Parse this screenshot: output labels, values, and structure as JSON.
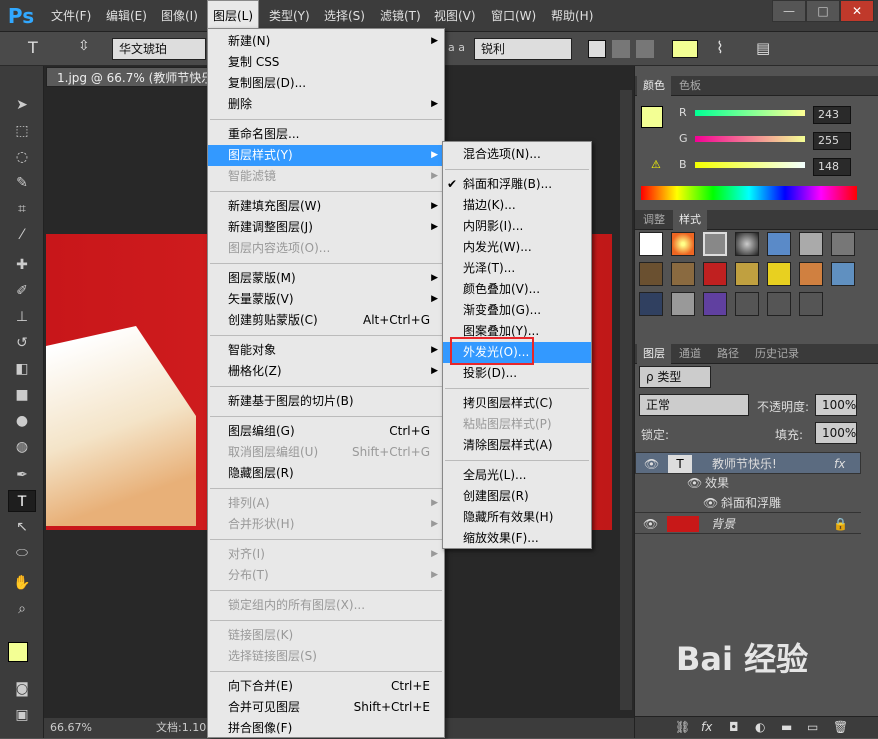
{
  "app": {
    "logo": "Ps"
  },
  "menubar": [
    "文件(F)",
    "编辑(E)",
    "图像(I)",
    "图层(L)",
    "类型(Y)",
    "选择(S)",
    "滤镜(T)",
    "视图(V)",
    "窗口(W)",
    "帮助(H)"
  ],
  "window_controls": [
    "—",
    "□",
    "✕"
  ],
  "options": {
    "tool_glyph": "T",
    "font": "华文琥珀",
    "aa_label": "a a",
    "aa_value": "锐利"
  },
  "document": {
    "tab": "1.jpg @ 66.7% (教师节快乐",
    "zoom": "66.67%",
    "doc_info": "文档:1.10"
  },
  "layer_menu": [
    {
      "label": "新建(N)",
      "arrow": true
    },
    {
      "label": "复制 CSS"
    },
    {
      "label": "复制图层(D)..."
    },
    {
      "label": "删除",
      "arrow": true
    },
    {
      "sep": true
    },
    {
      "label": "重命名图层..."
    },
    {
      "label": "图层样式(Y)",
      "arrow": true,
      "hl": true
    },
    {
      "label": "智能滤镜",
      "arrow": true,
      "dis": true
    },
    {
      "sep": true
    },
    {
      "label": "新建填充图层(W)",
      "arrow": true
    },
    {
      "label": "新建调整图层(J)",
      "arrow": true
    },
    {
      "label": "图层内容选项(O)...",
      "dis": true
    },
    {
      "sep": true
    },
    {
      "label": "图层蒙版(M)",
      "arrow": true
    },
    {
      "label": "矢量蒙版(V)",
      "arrow": true
    },
    {
      "label": "创建剪贴蒙版(C)",
      "sc": "Alt+Ctrl+G"
    },
    {
      "sep": true
    },
    {
      "label": "智能对象",
      "arrow": true
    },
    {
      "label": "栅格化(Z)",
      "arrow": true
    },
    {
      "sep": true
    },
    {
      "label": "新建基于图层的切片(B)"
    },
    {
      "sep": true
    },
    {
      "label": "图层编组(G)",
      "sc": "Ctrl+G"
    },
    {
      "label": "取消图层编组(U)",
      "sc": "Shift+Ctrl+G",
      "dis": true
    },
    {
      "label": "隐藏图层(R)"
    },
    {
      "sep": true
    },
    {
      "label": "排列(A)",
      "arrow": true,
      "dis": true
    },
    {
      "label": "合并形状(H)",
      "arrow": true,
      "dis": true
    },
    {
      "sep": true
    },
    {
      "label": "对齐(I)",
      "arrow": true,
      "dis": true
    },
    {
      "label": "分布(T)",
      "arrow": true,
      "dis": true
    },
    {
      "sep": true
    },
    {
      "label": "锁定组内的所有图层(X)...",
      "dis": true
    },
    {
      "sep": true
    },
    {
      "label": "链接图层(K)",
      "dis": true
    },
    {
      "label": "选择链接图层(S)",
      "dis": true
    },
    {
      "sep": true
    },
    {
      "label": "向下合并(E)",
      "sc": "Ctrl+E"
    },
    {
      "label": "合并可见图层",
      "sc": "Shift+Ctrl+E"
    },
    {
      "label": "拼合图像(F)"
    }
  ],
  "style_menu": [
    {
      "label": "混合选项(N)..."
    },
    {
      "sep": true
    },
    {
      "label": "斜面和浮雕(B)...",
      "check": true
    },
    {
      "label": "描边(K)..."
    },
    {
      "label": "内阴影(I)..."
    },
    {
      "label": "内发光(W)..."
    },
    {
      "label": "光泽(T)..."
    },
    {
      "label": "颜色叠加(V)..."
    },
    {
      "label": "渐变叠加(G)..."
    },
    {
      "label": "图案叠加(Y)..."
    },
    {
      "label": "外发光(O)...",
      "hl": true
    },
    {
      "label": "投影(D)..."
    },
    {
      "sep": true
    },
    {
      "label": "拷贝图层样式(C)"
    },
    {
      "label": "粘贴图层样式(P)",
      "dis": true
    },
    {
      "label": "清除图层样式(A)"
    },
    {
      "sep": true
    },
    {
      "label": "全局光(L)..."
    },
    {
      "label": "创建图层(R)"
    },
    {
      "label": "隐藏所有效果(H)"
    },
    {
      "label": "缩放效果(F)..."
    }
  ],
  "color_panel": {
    "tabs": [
      "颜色",
      "色板"
    ],
    "R": "243",
    "G": "255",
    "B": "148",
    "fg": "#f3ff94"
  },
  "styles_panel": {
    "tabs": [
      "调整",
      "样式"
    ]
  },
  "layers_panel": {
    "tabs": [
      "图层",
      "通道",
      "路径",
      "历史记录"
    ],
    "filter": "ρ 类型",
    "blend": "正常",
    "opacity_label": "不透明度:",
    "opacity": "100%",
    "lock_label": "锁定:",
    "fill_label": "填充:",
    "fill": "100%",
    "layers": [
      {
        "name": "教师节快乐!",
        "fx": "fx"
      },
      {
        "name": "效果"
      },
      {
        "name": "斜面和浮雕"
      },
      {
        "name": "背景"
      }
    ]
  },
  "watermark": "Bai 经验"
}
